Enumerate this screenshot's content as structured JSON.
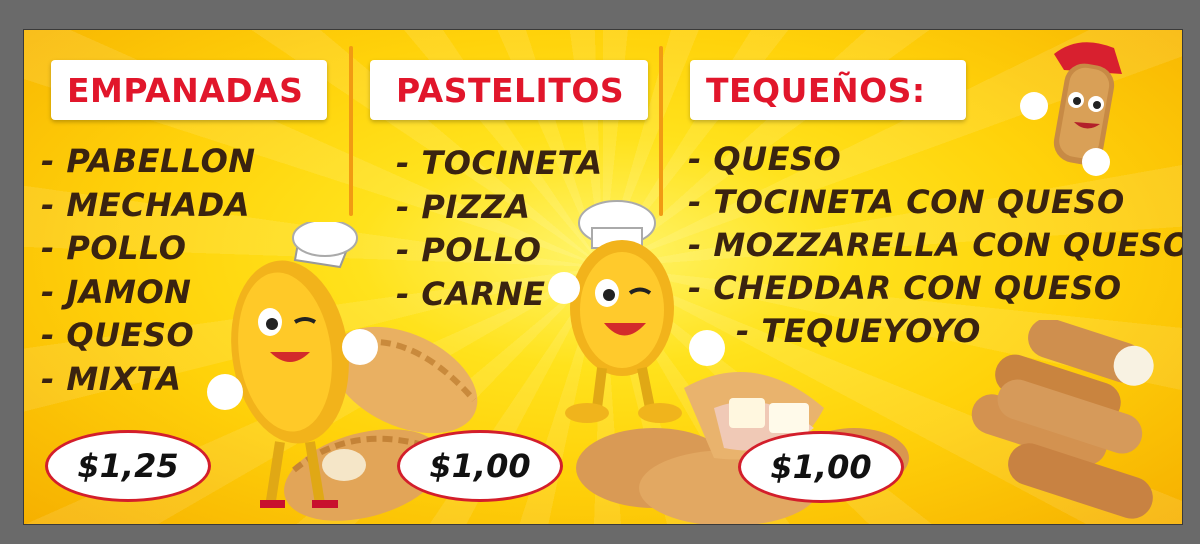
{
  "colors": {
    "background_yellow": "#ffd20a",
    "header_text_red": "#e1162b",
    "item_text_brown": "#3a2310",
    "price_border_red": "#d31e2b",
    "divider_orange": "#f19a13"
  },
  "empanadas": {
    "title": "EMPANADAS",
    "items": [
      "- PABELLON",
      "- MECHADA",
      "- POLLO",
      "- JAMON",
      "- QUESO",
      "- MIXTA"
    ],
    "price": "$1,25"
  },
  "pastelitos": {
    "title": "PASTELITOS",
    "items": [
      "- TOCINETA",
      "- PIZZA",
      "- POLLO",
      "- CARNE"
    ],
    "price": "$1,00"
  },
  "tequenos": {
    "title": "TEQUEÑOS:",
    "items": [
      "- QUESO",
      "- TOCINETA CON QUESO",
      "- MOZZARELLA CON QUESO",
      "- CHEDDAR CON QUESO",
      "- TEQUEYOYO"
    ],
    "price": "$1,00"
  },
  "icons": [
    "empanada-mascot-icon",
    "pastelito-mascot-icon",
    "tequeno-mascot-icon",
    "empanada-food-icon",
    "pastelito-food-icon",
    "tequenos-food-icon"
  ]
}
